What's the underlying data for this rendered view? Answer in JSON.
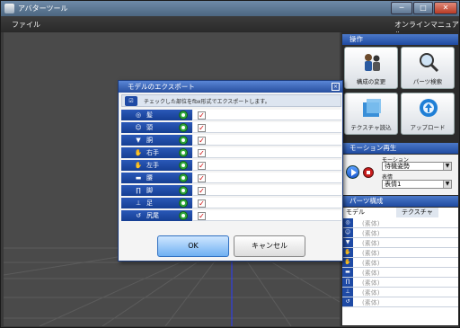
{
  "window": {
    "title": "アバターツール",
    "controls": {
      "minimize": "─",
      "maximize": "□",
      "close": "✕"
    }
  },
  "menubar": {
    "file": "ファイル",
    "manual": "オンラインマニュアル"
  },
  "panel": {
    "operations": {
      "title": "操作",
      "buttons": [
        {
          "label": "構成の変更",
          "icon": "people-icon"
        },
        {
          "label": "パーツ検索",
          "icon": "magnifier-icon"
        },
        {
          "label": "テクスチャ読込",
          "icon": "texture-folder-icon"
        },
        {
          "label": "アップロード",
          "icon": "upload-globe-icon"
        }
      ]
    },
    "motion": {
      "title": "モーション再生",
      "motion_label": "モーション",
      "motion_value": "待機姿勢",
      "expression_label": "表情",
      "expression_value": "表情1"
    },
    "parts": {
      "title": "パーツ構成",
      "tabs": [
        "モデル",
        "テクスチャ"
      ],
      "rows": [
        "(素体)",
        "(素体)",
        "(素体)",
        "(素体)",
        "(素体)",
        "(素体)",
        "(素体)",
        "(素体)",
        "(素体)"
      ]
    }
  },
  "dialog": {
    "title": "モデルのエクスポート",
    "close": "×",
    "description": "チェックした部位をfbx形式でエクスポートします。",
    "rows": [
      {
        "label": "髪",
        "icon": "hair-icon",
        "checked": true
      },
      {
        "label": "頭",
        "icon": "head-icon",
        "checked": true
      },
      {
        "label": "胴",
        "icon": "torso-icon",
        "checked": true
      },
      {
        "label": "右手",
        "icon": "right-hand-icon",
        "checked": true
      },
      {
        "label": "左手",
        "icon": "left-hand-icon",
        "checked": true
      },
      {
        "label": "腰",
        "icon": "waist-icon",
        "checked": true
      },
      {
        "label": "脚",
        "icon": "legs-icon",
        "checked": true
      },
      {
        "label": "足",
        "icon": "feet-icon",
        "checked": true
      },
      {
        "label": "尻尾",
        "icon": "tail-icon",
        "checked": true
      }
    ],
    "ok": "OK",
    "cancel": "キャンセル"
  },
  "colors": {
    "accent": "#1e4aa5",
    "toggle": "#2ea83b",
    "check": "#cc0000"
  }
}
